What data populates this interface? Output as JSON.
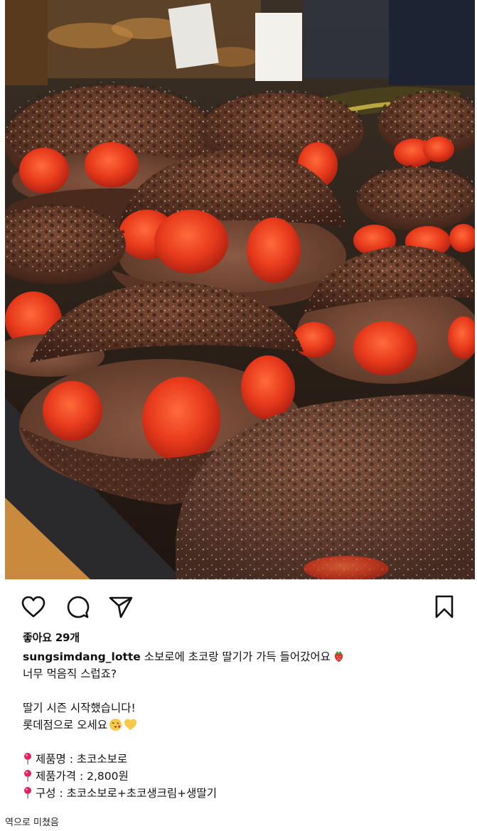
{
  "post": {
    "likes_label": "좋아요 29개",
    "username": "sungsimdang_lotte",
    "caption_first": "소보로에 초코랑 딸기가 가득 들어갔어요",
    "caption_lines": [
      "너무 먹음직 스럽죠?",
      "",
      "딸기 시즌 시작했습니다!",
      "롯데점으로 오세요"
    ],
    "details": [
      "제품명 :  초코소보로",
      "제품가격 : 2,800원",
      "구성 : 초코소보로+초코생크림+생딸기"
    ],
    "icons": {
      "like": "heart-icon",
      "comment": "comment-icon",
      "share": "send-icon",
      "save": "bookmark-icon",
      "pin": "round-pushpin-icon",
      "strawberry": "strawberry-emoji",
      "kiss": "face-blowing-kiss-emoji",
      "heart": "yellow-heart-emoji"
    }
  },
  "footer_text": "역으로 미쳤음",
  "colors": {
    "background": "#ffffff",
    "text": "#111111",
    "pin_red": "#e0245e",
    "yellow_heart": "#f7c948"
  }
}
